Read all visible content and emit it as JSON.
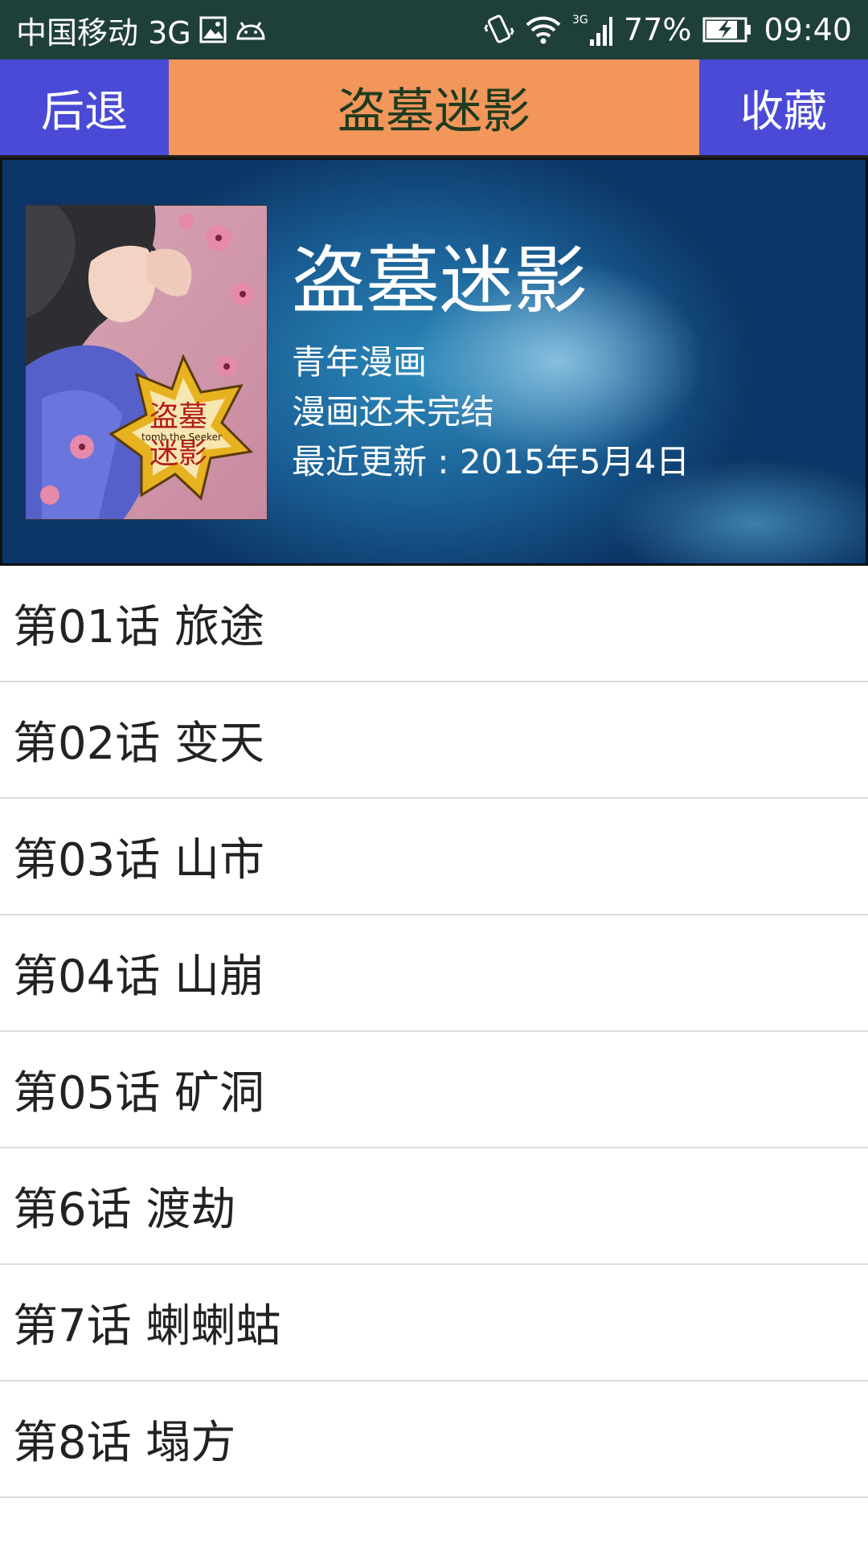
{
  "status_bar": {
    "carrier": "中国移动 3G",
    "battery": "77%",
    "time": "09:40"
  },
  "titlebar": {
    "back_label": "后退",
    "title": "盗墓迷影",
    "favorite_label": "收藏"
  },
  "comic": {
    "title": "盗墓迷影",
    "category": "青年漫画",
    "status": "漫画还未完结",
    "last_update": "最近更新 : 2015年5月4日",
    "cover_caption": "tomb the Seeker"
  },
  "chapters": [
    "第01话 旅途",
    "第02话 变天",
    "第03话 山市",
    "第04话 山崩",
    "第05话 矿洞",
    "第6话 渡劫",
    "第7话 蝲蝲蛄",
    "第8话 塌方"
  ],
  "colors": {
    "status_bar": "#1f3f3b",
    "nav_button": "#4a4ad6",
    "title_bg": "#f2965c",
    "title_text": "#1e3b1e"
  }
}
